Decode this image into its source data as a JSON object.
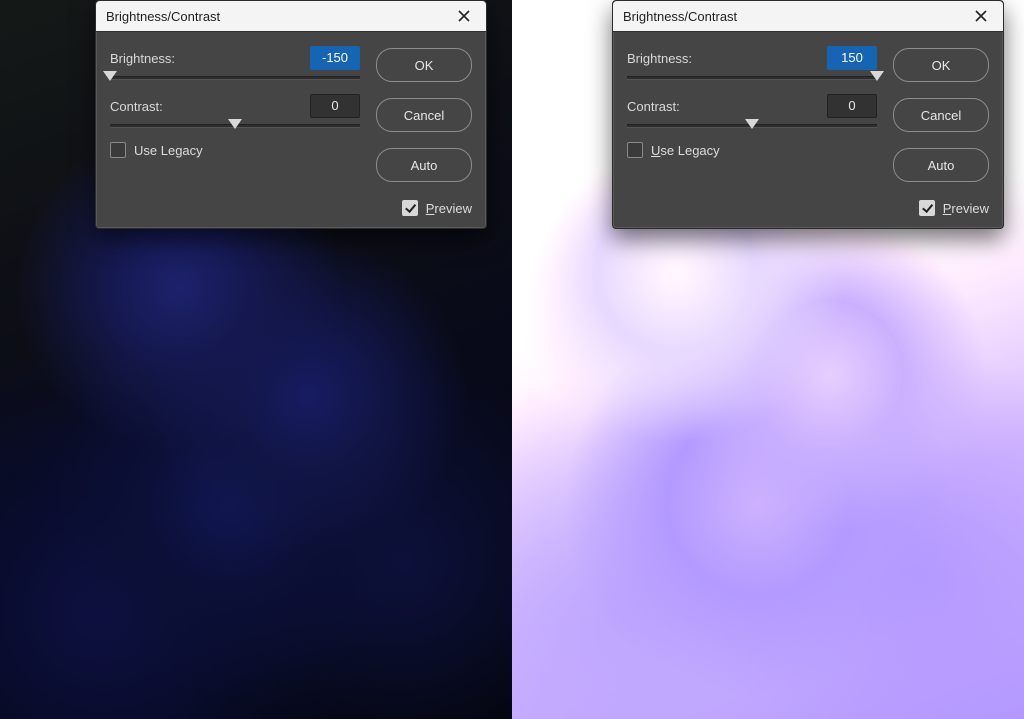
{
  "left": {
    "dialog_title": "Brightness/Contrast",
    "brightness": {
      "label": "Brightness:",
      "value": "-150",
      "slider_percent": 0
    },
    "contrast": {
      "label": "Contrast:",
      "value": "0",
      "slider_percent": 50
    },
    "use_legacy": {
      "label": "Use Legacy",
      "checked": false
    },
    "preview": {
      "label": "Preview",
      "checked": true
    },
    "buttons": {
      "ok": "OK",
      "cancel": "Cancel",
      "auto": "Auto"
    }
  },
  "right": {
    "dialog_title": "Brightness/Contrast",
    "brightness": {
      "label": "Brightness:",
      "value": "150",
      "slider_percent": 100
    },
    "contrast": {
      "label": "Contrast:",
      "value": "0",
      "slider_percent": 50
    },
    "use_legacy": {
      "label": "Use Legacy",
      "checked": false
    },
    "preview": {
      "label": "Preview",
      "checked": true
    },
    "buttons": {
      "ok": "OK",
      "cancel": "Cancel",
      "auto": "Auto"
    }
  }
}
